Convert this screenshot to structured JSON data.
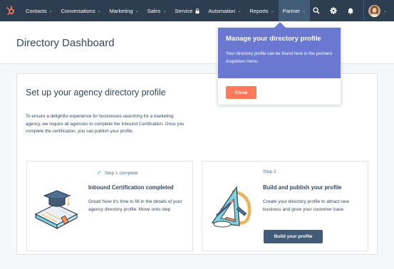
{
  "nav": {
    "items": [
      {
        "label": "Contacts",
        "has_chevron": true
      },
      {
        "label": "Conversations",
        "has_chevron": true
      },
      {
        "label": "Marketing",
        "has_chevron": true
      },
      {
        "label": "Sales",
        "has_chevron": true
      },
      {
        "label": "Service",
        "has_lock": true
      },
      {
        "label": "Automation",
        "has_chevron": true
      },
      {
        "label": "Reports",
        "has_chevron": true
      },
      {
        "label": "Partner",
        "has_chevron": true,
        "active": true
      }
    ],
    "chevron": "⌄",
    "icons": [
      "search-icon",
      "settings-gear-icon",
      "notifications-bell-icon"
    ],
    "brand_color": "#ff7a59",
    "nav_bg": "#2d3e50"
  },
  "header": {
    "title": "Directory Dashboard"
  },
  "main": {
    "title": "Set up your agency directory profile",
    "description": "To ensure a delightful experience for businesses searching for a marketing agency, we require all agencies to complete the Inbound Certification. Once you complete the certification, you can publish your profile.",
    "steps": [
      {
        "status_label": "Step 1 complete",
        "completed": true,
        "title": "Inbound Certification completed",
        "text": "Great! Now it's time to fill in the details of your agency directory profile. Move onto step"
      },
      {
        "status_label": "Step 2",
        "completed": false,
        "title": "Build and publish your profile",
        "text": "Create your directory profile to attract new business and grow your customer base",
        "button_label": "Build your profile"
      }
    ]
  },
  "popover": {
    "title": "Manage your directory profile",
    "body": "Your directory profile can be found here in the partners dropdown menu.",
    "close_label": "Close",
    "accent": "#6a78d1",
    "close_color": "#ff7a59"
  }
}
